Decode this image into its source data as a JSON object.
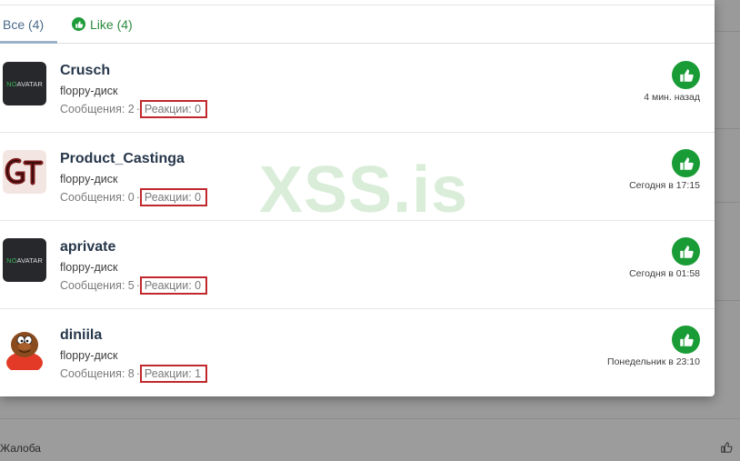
{
  "tabs": [
    {
      "label": "Все (4)"
    },
    {
      "label": "Like (4)"
    }
  ],
  "users": [
    {
      "name": "Crusch",
      "title": "floppy-диск",
      "messages": "Сообщения: 2",
      "reactions": "Реакции: 0",
      "time": "4 мин. назад",
      "avatar": "noavatar"
    },
    {
      "name": "Product_Castinga",
      "title": "floppy-диск",
      "messages": "Сообщения: 0",
      "reactions": "Реакции: 0",
      "time": "Сегодня в 17:15",
      "avatar": "gt-logo"
    },
    {
      "name": "aprivate",
      "title": "floppy-диск",
      "messages": "Сообщения: 5",
      "reactions": "Реакции: 0",
      "time": "Сегодня в 01:58",
      "avatar": "noavatar"
    },
    {
      "name": "diniila",
      "title": "floppy-диск",
      "messages": "Сообщения: 8",
      "reactions": "Реакции: 1",
      "time": "Понедельник в 23:10",
      "avatar": "cartoon-character"
    }
  ],
  "noavatar": {
    "no": "NO",
    "avatar": "AVATAR"
  },
  "watermark": "XSS.is",
  "footer": {
    "report": "Жалоба"
  },
  "colors": {
    "like_green": "#199c36",
    "highlight_red": "#c0282d"
  },
  "icons": {
    "reaction": "thumbs-up-icon",
    "tab_like": "thumbs-up-icon"
  }
}
